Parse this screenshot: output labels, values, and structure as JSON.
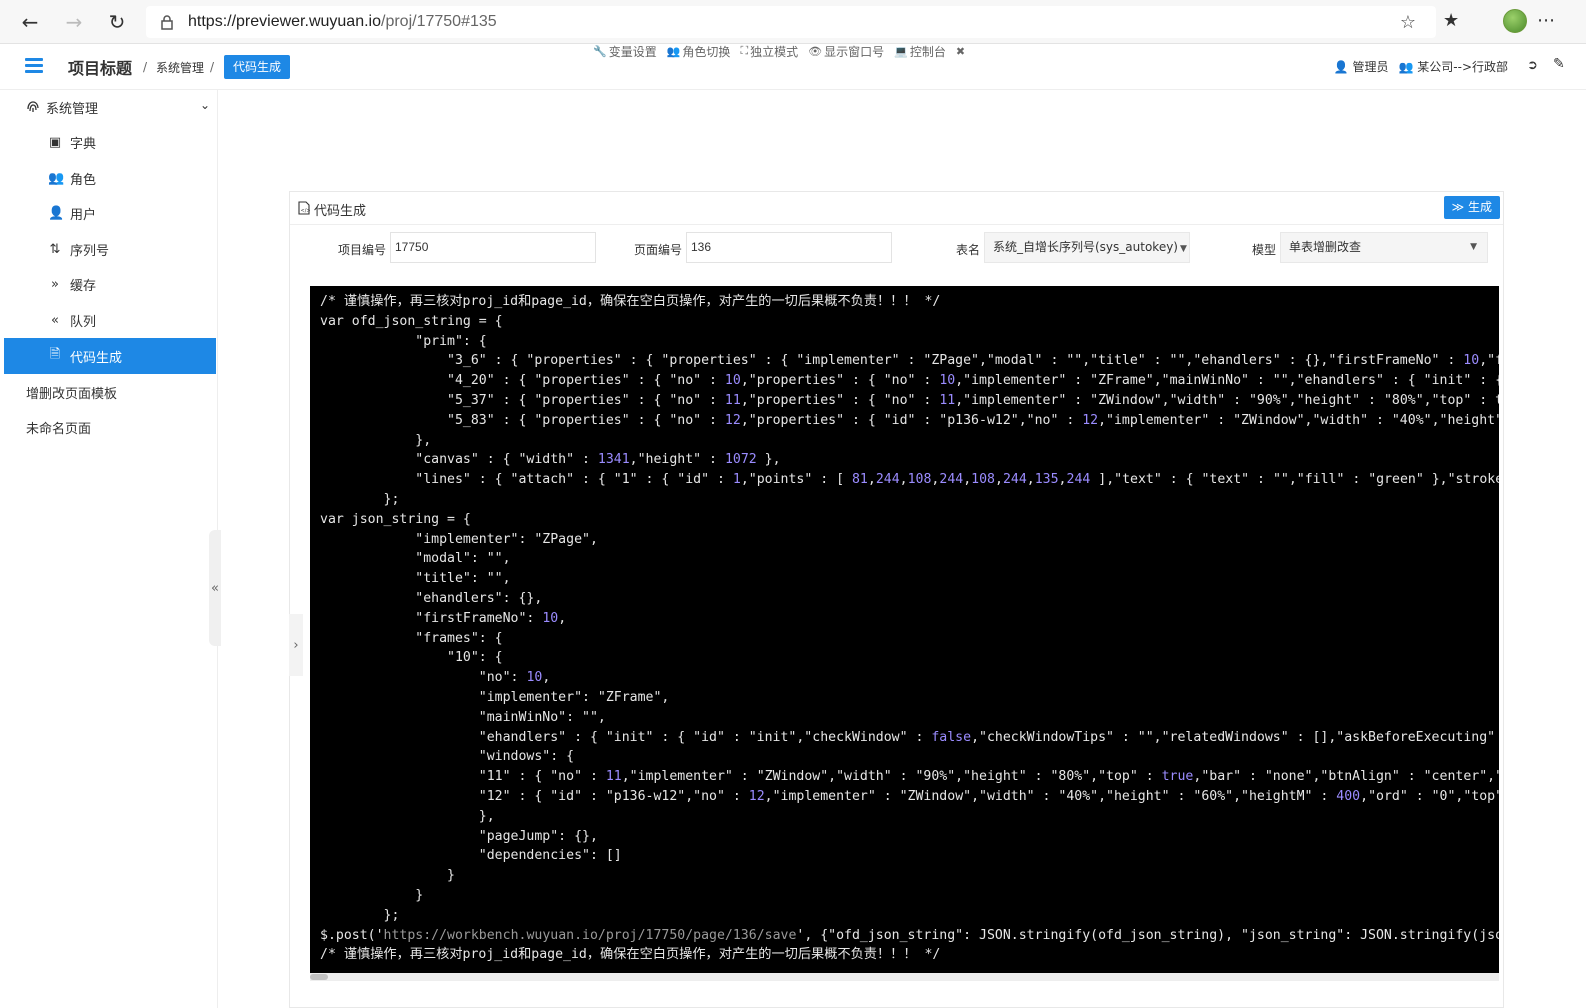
{
  "browser": {
    "url_host": "https://previewer.wuyuan.io",
    "url_path": "/proj/17750#135"
  },
  "header": {
    "project_title": "项目标题",
    "breadcrumb": [
      "系统管理",
      "代码生成"
    ],
    "toolbar": [
      "变量设置",
      "角色切换",
      "独立模式",
      "显示窗口号",
      "控制台"
    ],
    "user": "管理员",
    "org": "某公司-->行政部"
  },
  "sidebar": {
    "group": "系统管理",
    "items": [
      {
        "label": "字典",
        "icon": "book-icon"
      },
      {
        "label": "角色",
        "icon": "users-icon"
      },
      {
        "label": "用户",
        "icon": "user-icon"
      },
      {
        "label": "序列号",
        "icon": "sort-icon"
      },
      {
        "label": "缓存",
        "icon": "double-right-icon"
      },
      {
        "label": "队列",
        "icon": "double-left-icon"
      },
      {
        "label": "代码生成",
        "icon": "file-code-icon"
      }
    ],
    "top_items": [
      "增删改页面模板",
      "未命名页面"
    ]
  },
  "panel": {
    "title": "代码生成",
    "generate_button": "生成",
    "fields": {
      "project_no_label": "项目编号",
      "project_no": "17750",
      "page_no_label": "页面编号",
      "page_no": "136",
      "table_label": "表名",
      "table_value": "系统_自增长序列号(sys_autokey)",
      "model_label": "模型",
      "model_value": "单表增删改查"
    }
  },
  "code_lines": [
    "/* 谨慎操作，再三核对proj_id和page_id，确保在空白页操作，对产生的一切后果概不负责！！！ */",
    "var ofd_json_string = {",
    "            \"prim\": {",
    "                \"3_6\" : { \"properties\" : { \"properties\" : { \"implementer\" : \"ZPage\",\"modal\" : \"\",\"title\" : \"\",\"ehandlers\" : {},\"firstFrameNo\" : 10,\"f",
    "                \"4_20\" : { \"properties\" : { \"no\" : 10,\"properties\" : { \"no\" : 10,\"implementer\" : \"ZFrame\",\"mainWinNo\" : \"\",\"ehandlers\" : { \"init\" : {",
    "                \"5_37\" : { \"properties\" : { \"no\" : 11,\"properties\" : { \"no\" : 11,\"implementer\" : \"ZWindow\",\"width\" : \"90%\",\"height\" : \"80%\",\"top\" : t",
    "                \"5_83\" : { \"properties\" : { \"no\" : 12,\"properties\" : { \"id\" : \"p136-w12\",\"no\" : 12,\"implementer\" : \"ZWindow\",\"width\" : \"40%\",\"height\"",
    "            },",
    "            \"canvas\" : { \"width\" : 1341,\"height\" : 1072 },",
    "            \"lines\" : { \"attach\" : { \"1\" : { \"id\" : 1,\"points\" : [ 81,244,108,244,108,244,135,244 ],\"text\" : { \"text\" : \"\",\"fill\" : \"green\" },\"stroke",
    "        };",
    "var json_string = {",
    "            \"implementer\": \"ZPage\",",
    "            \"modal\": \"\",",
    "            \"title\": \"\",",
    "            \"ehandlers\": {},",
    "            \"firstFrameNo\": 10,",
    "            \"frames\": {",
    "                \"10\": {",
    "                    \"no\": 10,",
    "                    \"implementer\": \"ZFrame\",",
    "                    \"mainWinNo\": \"\",",
    "                    \"ehandlers\" : { \"init\" : { \"id\" : \"init\",\"checkWindow\" : false,\"checkWindowTips\" : \"\",\"relatedWindows\" : [],\"askBeforeExecuting\"",
    "                    \"windows\": {",
    "                    \"11\" : { \"no\" : 11,\"implementer\" : \"ZWindow\",\"width\" : \"90%\",\"height\" : \"80%\",\"top\" : true,\"bar\" : \"none\",\"btnAlign\" : \"center\",\"",
    "                    \"12\" : { \"id\" : \"p136-w12\",\"no\" : 12,\"implementer\" : \"ZWindow\",\"width\" : \"40%\",\"height\" : \"60%\",\"heightM\" : 400,\"ord\" : \"0\",\"top\"",
    "                    },",
    "                    \"pageJump\": {},",
    "                    \"dependencies\": []",
    "                }",
    "            }",
    "        };",
    "$.post('https://workbench.wuyuan.io/proj/17750/page/136/save', {\"ofd_json_string\": JSON.stringify(ofd_json_string), \"json_string\": JSON.stringify(jso",
    "/* 谨慎操作，再三核对proj_id和page_id，确保在空白页操作，对产生的一切后果概不负责！！！ */"
  ]
}
